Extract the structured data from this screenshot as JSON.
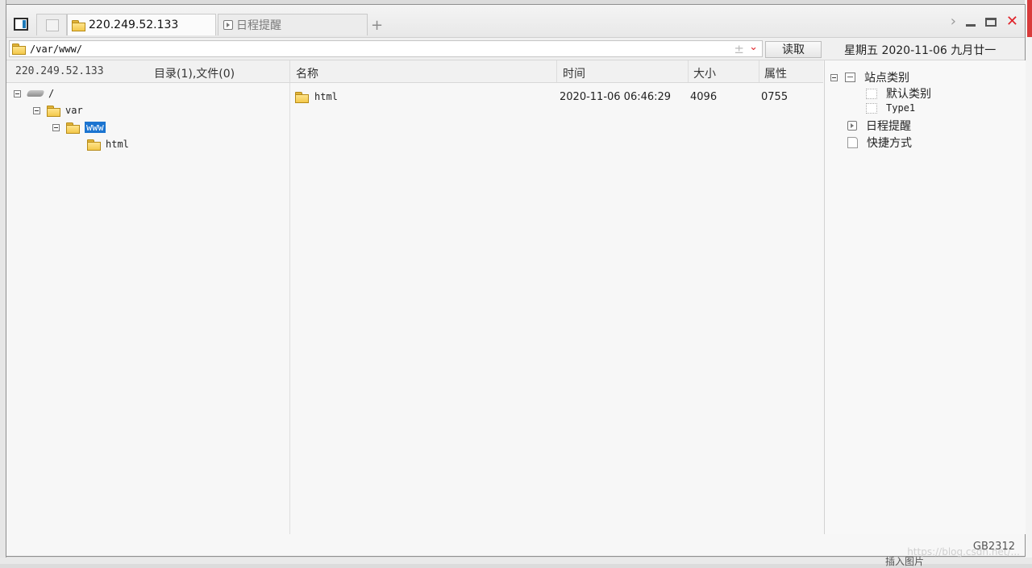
{
  "tabs": {
    "active": {
      "label": "220.249.52.133"
    },
    "inactive": {
      "label": "日程提醒"
    },
    "add_label": "+"
  },
  "window_controls": {
    "next": "›",
    "close": "✕"
  },
  "address_bar": {
    "path": "/var/www/",
    "plus": "±",
    "dropdown": "⌄",
    "read_button": "读取",
    "date": "星期五 2020-11-06 九月廿一"
  },
  "left_header": {
    "host": "220.249.52.133",
    "counts": "目录(1),文件(0)"
  },
  "columns": {
    "name": "名称",
    "time": "时间",
    "size": "大小",
    "attr": "属性"
  },
  "tree": {
    "root": "/",
    "var": "var",
    "www": "www",
    "html": "html"
  },
  "files": [
    {
      "name": "html",
      "time": "2020-11-06 06:46:29",
      "size": "4096",
      "attr": "0755"
    }
  ],
  "right_panel": {
    "site_category": "站点类别",
    "default_category": "默认类别",
    "type1": "Type1",
    "schedule": "日程提醒",
    "shortcut": "快捷方式"
  },
  "status": {
    "encoding": "GB2312",
    "watermark": "https://blog.csdn.net/..."
  },
  "background": {
    "bottom_text": "插入图片"
  }
}
